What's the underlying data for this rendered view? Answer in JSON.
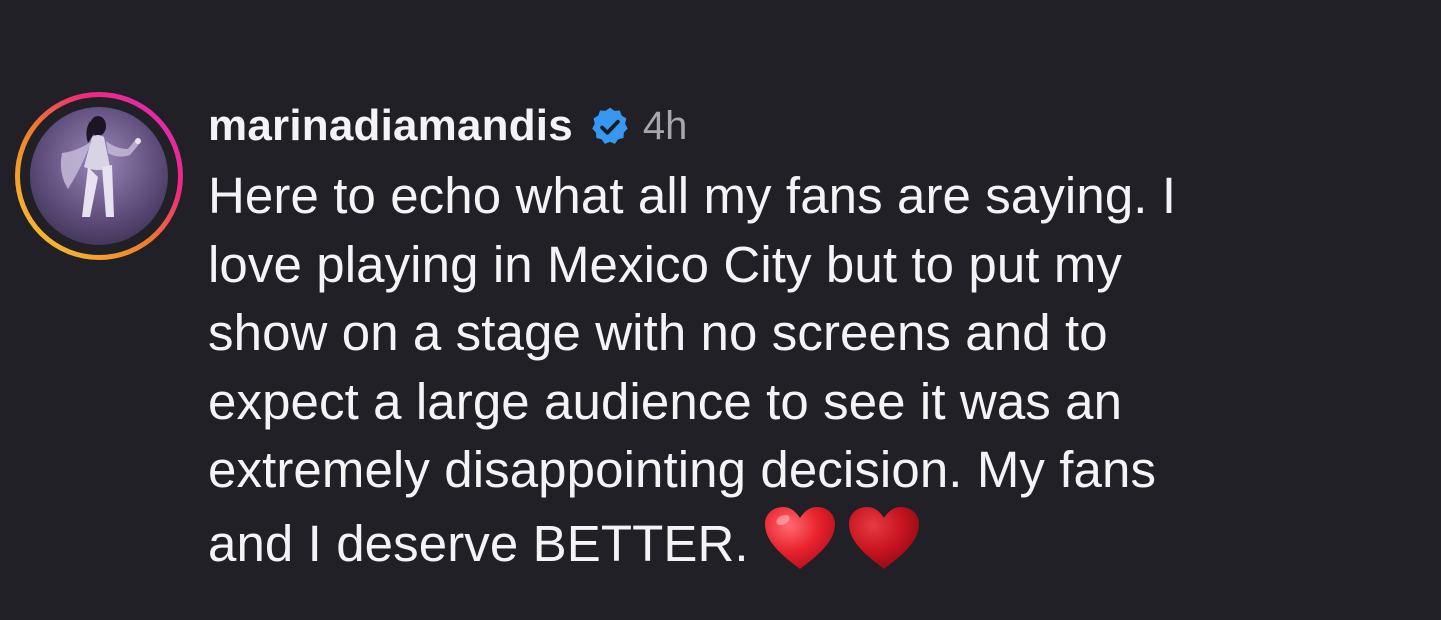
{
  "comment": {
    "username": "marinadiamandis",
    "verified": true,
    "time_ago": "4h",
    "text_lines": [
      "Here to echo what all my fans are saying. I",
      "love playing in Mexico City but to put my",
      "show on a stage with no screens and to",
      "expect a large audience to see it was an",
      "extremely disappointing decision. My fans",
      "and I deserve BETTER."
    ],
    "emojis": [
      "heart-icon",
      "heart-icon"
    ]
  },
  "colors": {
    "background": "#202026",
    "text": "#f4f4f6",
    "muted": "#a6a6ad",
    "verified_blue": "#3897f0",
    "heart_red": "#e8232e",
    "story_ring_start": "#f9ce34",
    "story_ring_mid": "#ee2a7b",
    "story_ring_end": "#d62ad0"
  }
}
